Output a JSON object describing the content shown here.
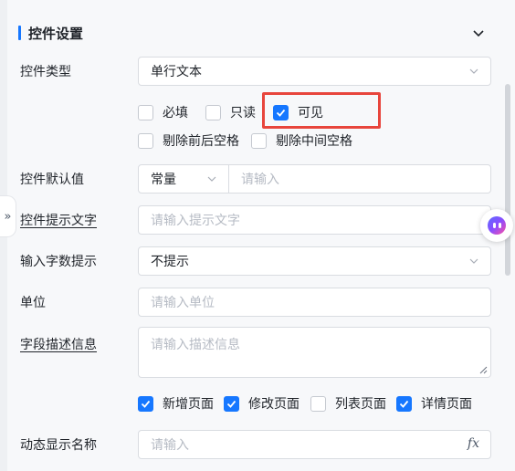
{
  "section": {
    "title": "控件设置"
  },
  "control_type": {
    "label": "控件类型",
    "value": "单行文本"
  },
  "options": [
    {
      "label": "必填",
      "checked": false
    },
    {
      "label": "只读",
      "checked": false
    },
    {
      "label": "可见",
      "checked": true
    },
    {
      "label": "剔除前后空格",
      "checked": false
    },
    {
      "label": "剔除中间空格",
      "checked": false
    }
  ],
  "default_value": {
    "label": "控件默认值",
    "mode": "常量",
    "placeholder": "请输入"
  },
  "hint_text": {
    "label": "控件提示文字",
    "placeholder": "请输入提示文字"
  },
  "char_count_hint": {
    "label": "输入字数提示",
    "value": "不提示"
  },
  "unit": {
    "label": "单位",
    "placeholder": "请输入单位"
  },
  "field_description": {
    "label": "字段描述信息",
    "placeholder": "请输入描述信息"
  },
  "pages": [
    {
      "label": "新增页面",
      "checked": true
    },
    {
      "label": "修改页面",
      "checked": true
    },
    {
      "label": "列表页面",
      "checked": false
    },
    {
      "label": "详情页面",
      "checked": true
    }
  ],
  "dynamic_name": {
    "label": "动态显示名称",
    "placeholder": "请输入",
    "fx": "fx"
  },
  "collapse_tab": {
    "glyph": "»"
  },
  "colors": {
    "accent": "#1677ff",
    "highlight": "#e8453c",
    "border": "#d9dce1"
  }
}
